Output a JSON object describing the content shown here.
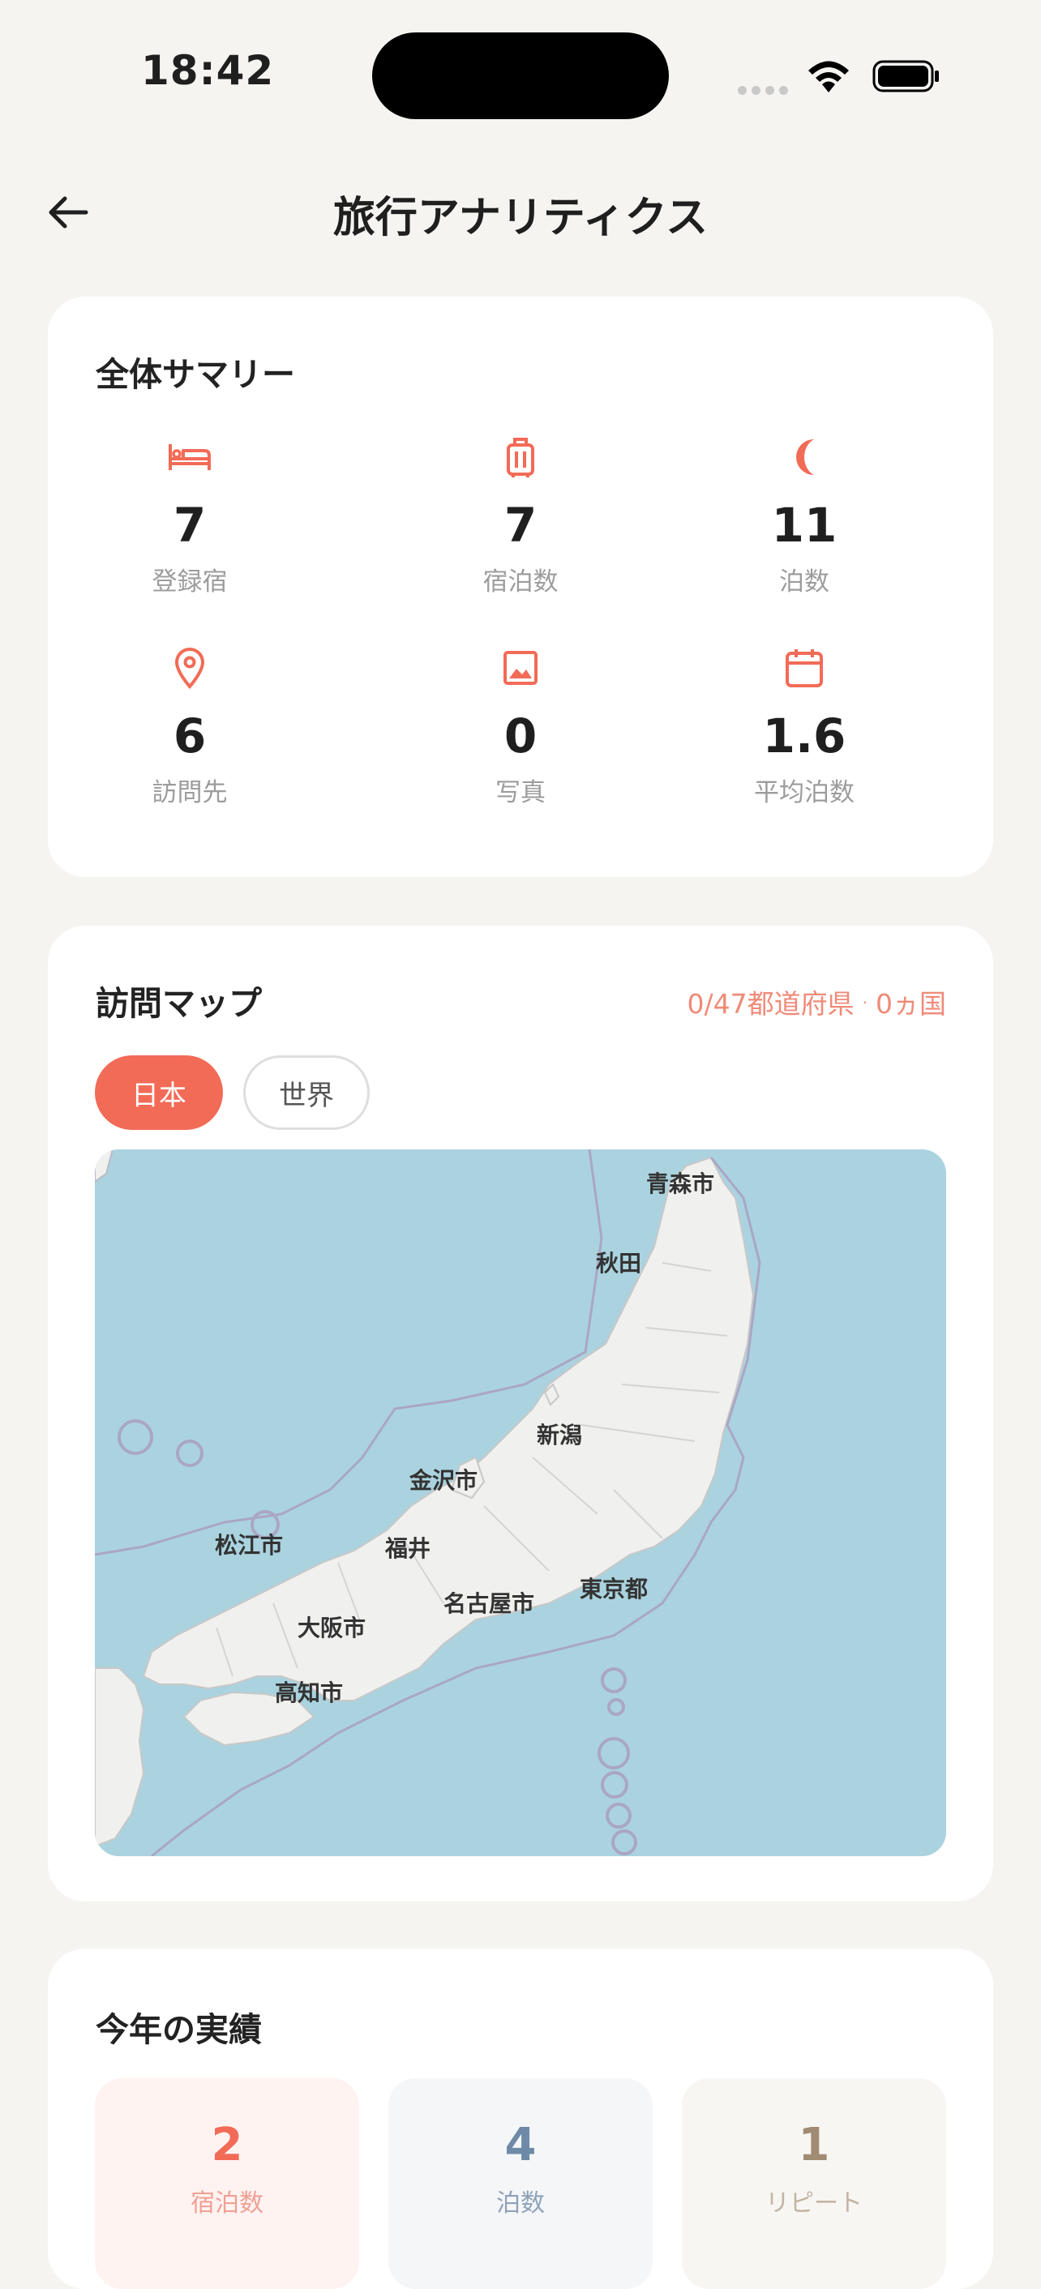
{
  "status": {
    "time": "18:42"
  },
  "header": {
    "title": "旅行アナリティクス"
  },
  "summary": {
    "title": "全体サマリー",
    "stats": [
      {
        "icon": "bed-icon",
        "value": "7",
        "label": "登録宿"
      },
      {
        "icon": "suitcase-icon",
        "value": "7",
        "label": "宿泊数"
      },
      {
        "icon": "moon-icon",
        "value": "11",
        "label": "泊数"
      },
      {
        "icon": "location-pin-icon",
        "value": "6",
        "label": "訪問先"
      },
      {
        "icon": "photo-icon",
        "value": "0",
        "label": "写真"
      },
      {
        "icon": "calendar-icon",
        "value": "1.6",
        "label": "平均泊数"
      }
    ]
  },
  "map": {
    "title": "訪問マップ",
    "prefectures": "0/47都道府県",
    "countries": "0ヵ国",
    "separator": "·",
    "tabs": [
      {
        "label": "日本",
        "active": true
      },
      {
        "label": "世界",
        "active": false
      }
    ],
    "places": [
      "青森市",
      "秋田",
      "新潟",
      "金沢市",
      "福井",
      "松江市",
      "大阪市",
      "名古屋市",
      "東京都",
      "高知市"
    ]
  },
  "year": {
    "title": "今年の実績",
    "tiles": [
      {
        "value": "2",
        "label": "宿泊数"
      },
      {
        "value": "4",
        "label": "泊数"
      },
      {
        "value": "1",
        "label": "リピート"
      }
    ]
  },
  "colors": {
    "accent": "#f26b57",
    "sea": "#aad3df",
    "land": "#f0f0ef"
  }
}
